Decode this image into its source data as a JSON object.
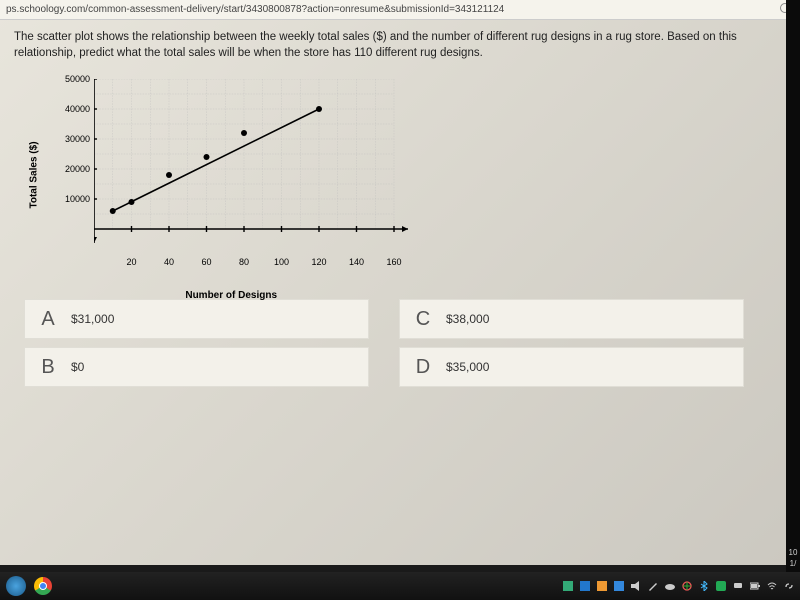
{
  "url": "ps.schoology.com/common-assessment-delivery/start/3430800878?action=onresume&submissionId=343121124",
  "question": "The scatter plot shows the relationship between the weekly total sales ($) and the number of different rug designs in a rug store. Based on this relationship, predict what the total sales will be when the store has 110 different rug designs.",
  "answers": {
    "a": {
      "letter": "A",
      "value": "$31,000"
    },
    "b": {
      "letter": "B",
      "value": "$0"
    },
    "c": {
      "letter": "C",
      "value": "$38,000"
    },
    "d": {
      "letter": "D",
      "value": "$35,000"
    }
  },
  "chart_data": {
    "type": "scatter",
    "title": "",
    "xlabel": "Number of Designs",
    "ylabel": "Total Sales ($)",
    "xlim": [
      0,
      160
    ],
    "ylim": [
      0,
      50000
    ],
    "xticks": [
      20,
      40,
      60,
      80,
      100,
      120,
      140,
      160
    ],
    "yticks": [
      10000,
      20000,
      30000,
      40000,
      50000
    ],
    "grid": true,
    "points": [
      {
        "x": 10,
        "y": 6000
      },
      {
        "x": 20,
        "y": 9000
      },
      {
        "x": 40,
        "y": 18000
      },
      {
        "x": 60,
        "y": 24000
      },
      {
        "x": 80,
        "y": 32000
      },
      {
        "x": 120,
        "y": 40000
      }
    ],
    "trend_line": {
      "from": {
        "x": 10,
        "y": 6000
      },
      "to": {
        "x": 120,
        "y": 40000
      }
    }
  },
  "edge": {
    "top": "10",
    "bot": "1/"
  }
}
